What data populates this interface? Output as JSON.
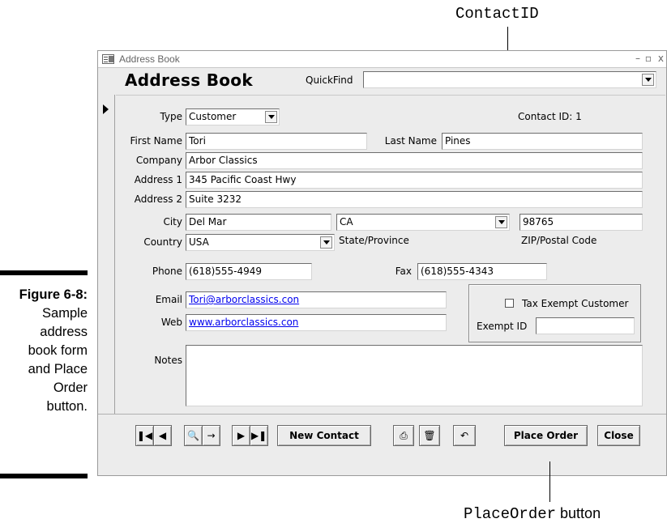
{
  "callouts": {
    "top_code": "ContactID",
    "bottom_code": "PlaceOrder",
    "bottom_word": " button"
  },
  "caption": {
    "figure": "Figure 6-8:",
    "text_lines": [
      "Sample",
      "address",
      "book form",
      "and Place",
      "Order",
      "button."
    ]
  },
  "window": {
    "title": "Address Book",
    "form_title": "Address Book",
    "quickfind_label": "QuickFind",
    "quickfind_value": ""
  },
  "form": {
    "type_label": "Type",
    "type_value": "Customer",
    "contact_id_text": "Contact ID: 1",
    "first_name_label": "First Name",
    "first_name": "Tori",
    "last_name_label": "Last Name",
    "last_name": "Pines",
    "company_label": "Company",
    "company": "Arbor Classics",
    "address1_label": "Address 1",
    "address1": "345 Pacific Coast Hwy",
    "address2_label": "Address 2",
    "address2": "Suite 3232",
    "city_label": "City",
    "city": "Del Mar",
    "state": "CA",
    "state_label": "State/Province",
    "zip": "98765",
    "zip_label": "ZIP/Postal Code",
    "country_label": "Country",
    "country": "USA",
    "phone_label": "Phone",
    "phone": "(618)555-4949",
    "fax_label": "Fax",
    "fax": "(618)555-4343",
    "email_label": "Email",
    "email": "Tori@arborclassics.con",
    "web_label": "Web",
    "web": "www.arborclassics.con",
    "tax_exempt_label": "Tax Exempt Customer",
    "tax_exempt_checked": false,
    "exempt_id_label": "Exempt ID",
    "exempt_id": "",
    "notes_label": "Notes",
    "notes": ""
  },
  "footer": {
    "first_icon": "first-record-icon",
    "prev_icon": "previous-record-icon",
    "find_icon": "binoculars-icon",
    "find_next_icon": "find-next-icon",
    "next_icon": "next-record-icon",
    "last_icon": "last-record-icon",
    "new_contact": "New Contact",
    "print_icon": "printer-icon",
    "delete_icon": "trash-icon",
    "undo_icon": "undo-icon",
    "place_order": "Place Order",
    "close": "Close"
  }
}
